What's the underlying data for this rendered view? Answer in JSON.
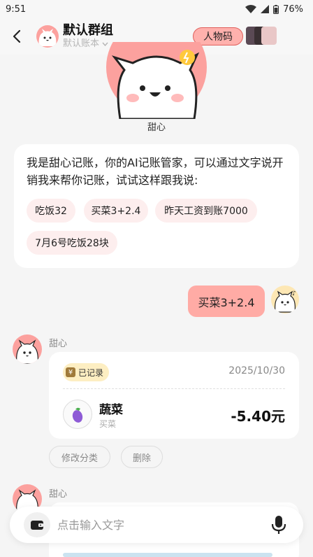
{
  "status_bar": {
    "time": "9:51",
    "battery": "76%"
  },
  "header": {
    "title": "默认群组",
    "subtitle": "默认账本",
    "character_code_button": "人物码"
  },
  "character": {
    "name": "甜心"
  },
  "intro": {
    "text": "我是甜心记账，你的AI记账管家，可以通过文字说开销我来帮你记账，试试这样跟我说:",
    "suggestions": [
      "吃饭32",
      "买菜3+2.4",
      "昨天工资到账7000",
      "7月6号吃饭28块"
    ]
  },
  "user_message": {
    "text": "买菜3+2.4"
  },
  "bot_reply": {
    "sender": "甜心",
    "badge": "已记录",
    "badge_icon_char": "¥",
    "date": "2025/10/30",
    "category": "蔬菜",
    "note": "买菜",
    "amount": "-5.40元",
    "actions": {
      "edit": "修改分类",
      "delete": "删除"
    }
  },
  "next_message": {
    "sender": "甜心"
  },
  "input": {
    "placeholder": "点击输入文字"
  },
  "colors": {
    "accent": "#ffaba5",
    "character_bg": "#fca19e",
    "badge_bg": "#fdeec2"
  }
}
